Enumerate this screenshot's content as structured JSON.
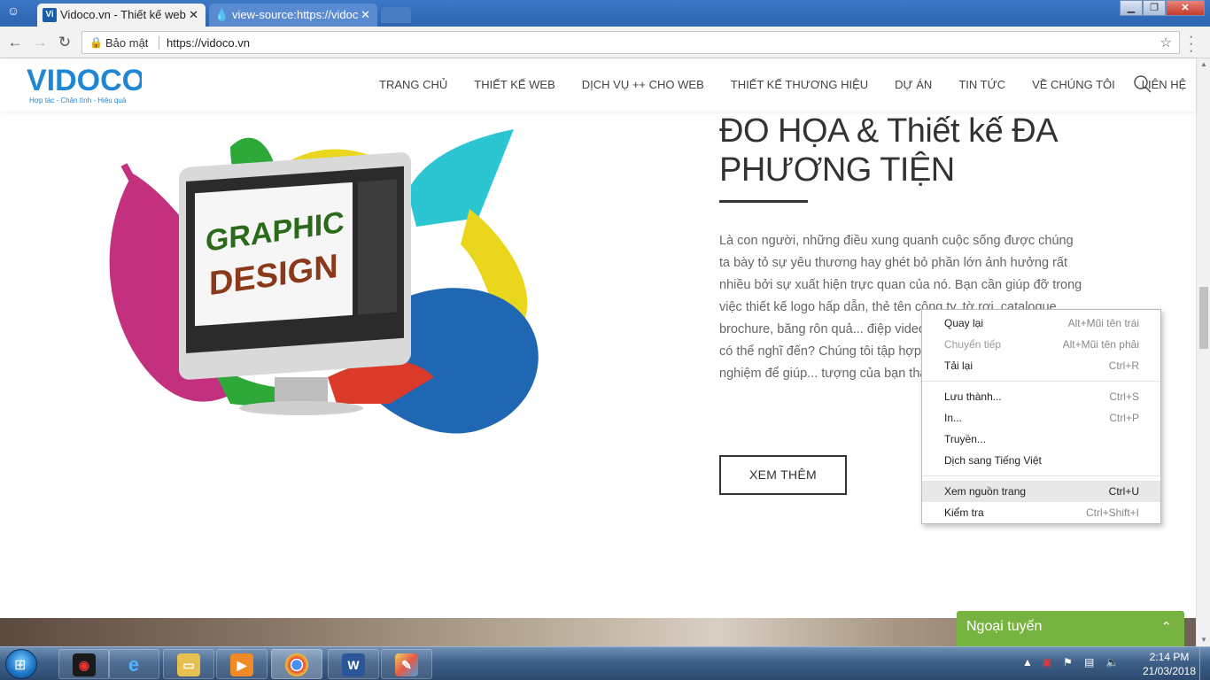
{
  "browser": {
    "tabs": [
      {
        "title": "Vidoco.vn - Thiết kế web",
        "favicon": "Vi",
        "close": "✕"
      },
      {
        "title": "view-source:https://vidoc",
        "favicon": "💧",
        "close": "✕"
      }
    ],
    "window_buttons": {
      "minimize": "▁",
      "maximize": "❐",
      "close": "✕"
    },
    "security_label": "Bảo mật",
    "url": "https://vidoco.vn"
  },
  "site": {
    "logo_text": "VIDOCO",
    "logo_tagline": "Hợp tác - Chân tình - Hiệu quả",
    "nav": [
      "TRANG CHỦ",
      "THIẾT KẾ WEB",
      "DỊCH VỤ ++ CHO WEB",
      "THIẾT KẾ THƯƠNG HIỆU",
      "DỰ ÁN",
      "TIN TỨC",
      "VỀ CHÚNG TÔI",
      "LIÊN HỆ"
    ]
  },
  "section": {
    "heading": "ĐO HỌA & Thiết kế ĐA PHƯƠNG TIỆN",
    "description": "Là con người, những điều xung quanh cuộc sống được chúng ta bày tỏ sự yêu thương hay ghét bỏ phần lớn ảnh hưởng rất nhiều bởi sự xuất hiện trực quan của nó. Bạn cần giúp đỡ trong việc thiết kế logo hấp dẫn, thẻ tên công ty, tờ rơi, catalogue, brochure, băng rôn quả... điệp video truyền thông ấn tượng h... có thể nghĩ đến? Chúng tôi tập hợp... kế đồ họa giàu kinh nghiệm để giúp... tượng của bạn thành một kiệt tác.",
    "art_text_1": "GRAPHIC",
    "art_text_2": "DESIGN",
    "cta": "XEM THÊM"
  },
  "context_menu": {
    "items": [
      {
        "label": "Quay lại",
        "shortcut": "Alt+Mũi tên trái",
        "disabled": false
      },
      {
        "label": "Chuyển tiếp",
        "shortcut": "Alt+Mũi tên phải",
        "disabled": true
      },
      {
        "label": "Tải lại",
        "shortcut": "Ctrl+R",
        "disabled": false
      },
      {
        "label": "Lưu thành...",
        "shortcut": "Ctrl+S",
        "disabled": false
      },
      {
        "label": "In...",
        "shortcut": "Ctrl+P",
        "disabled": false
      },
      {
        "label": "Truyền...",
        "shortcut": "",
        "disabled": false
      },
      {
        "label": "Dịch sang Tiếng Việt",
        "shortcut": "",
        "disabled": false
      },
      {
        "label": "Xem nguồn trang",
        "shortcut": "Ctrl+U",
        "disabled": false,
        "highlighted": true
      },
      {
        "label": "Kiểm tra",
        "shortcut": "Ctrl+Shift+I",
        "disabled": false
      }
    ]
  },
  "chat": {
    "label": "Ngoại tuyến",
    "chevron": "⌃"
  },
  "taskbar": {
    "time": "2:14 PM",
    "date": "21/03/2018",
    "apps": [
      "garena-icon",
      "internet-explorer-icon",
      "file-explorer-icon",
      "media-player-icon",
      "chrome-icon",
      "word-icon",
      "paint-icon"
    ]
  },
  "colors": {
    "accent": "#1f86d4",
    "chat": "#77b341",
    "taskbar": "#3e5f88"
  }
}
